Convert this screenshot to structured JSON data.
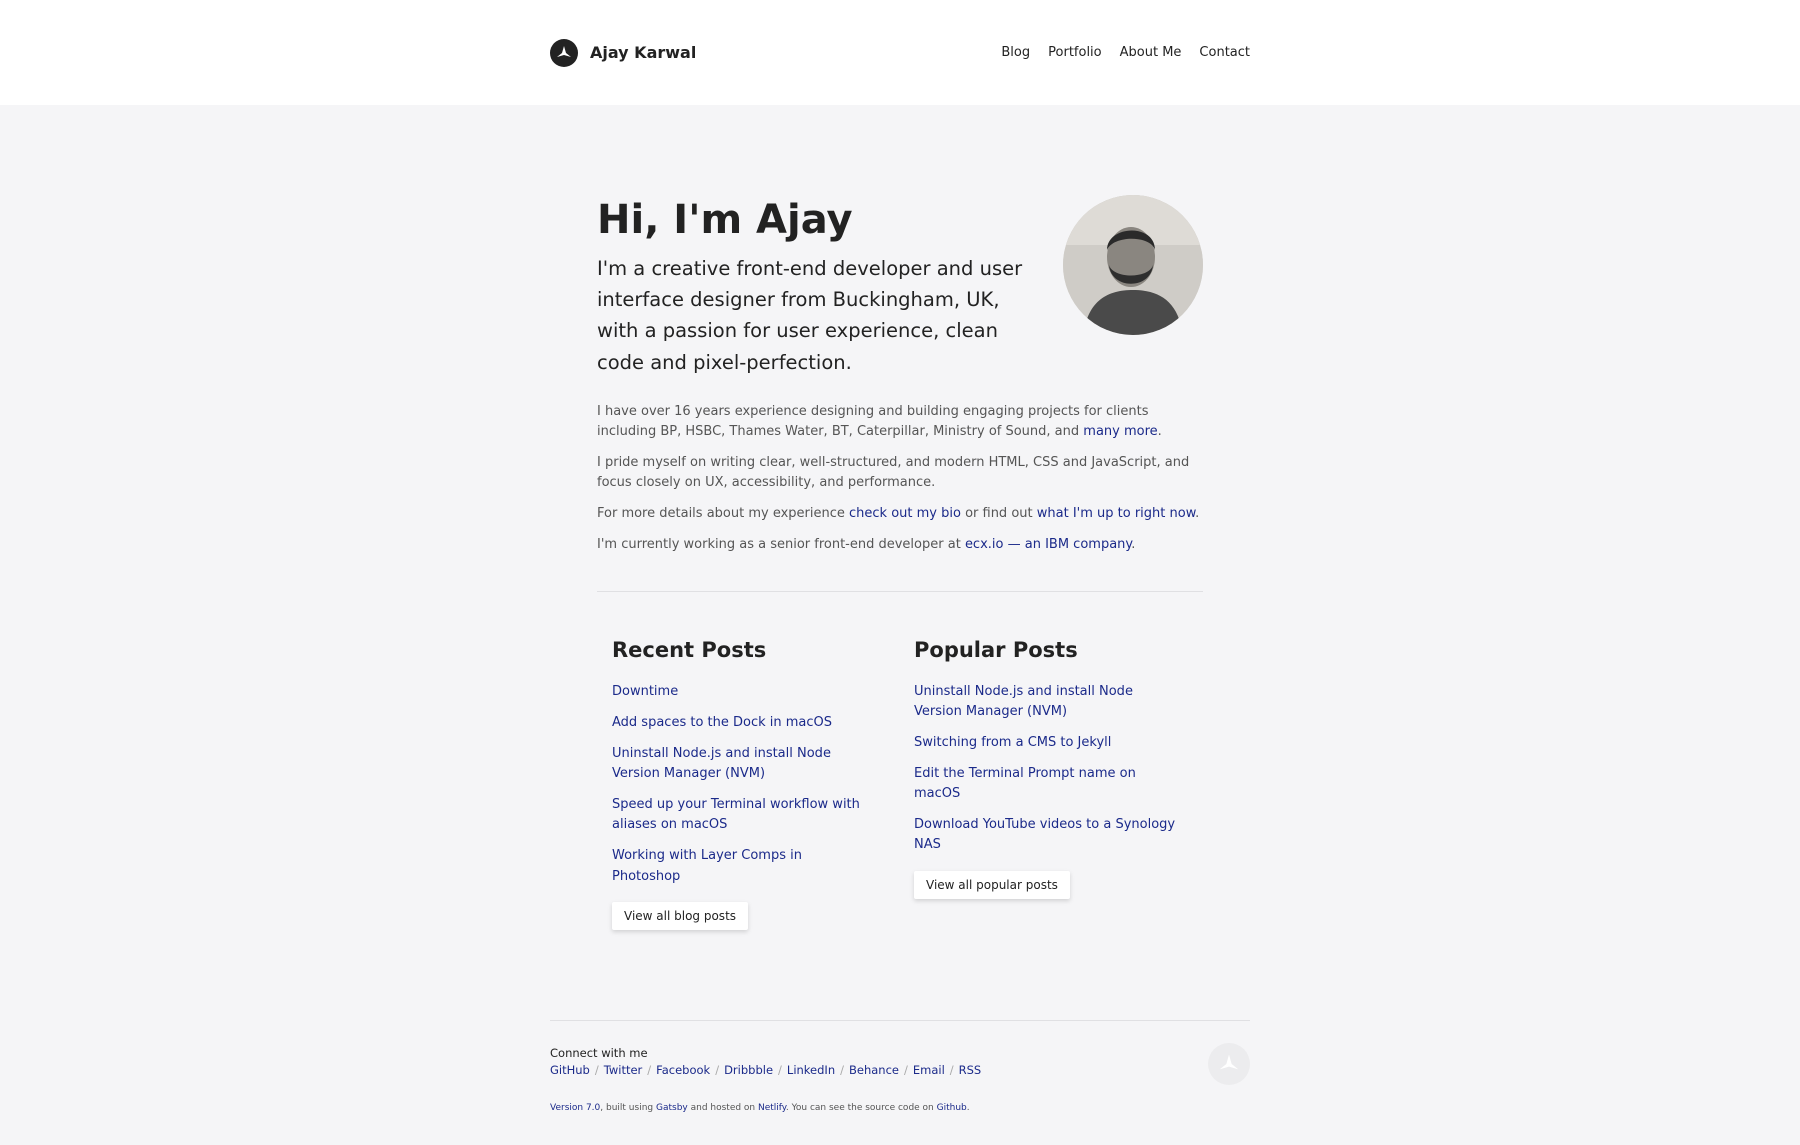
{
  "header": {
    "logo_icon": "ajay-karwal-logo",
    "brand_name": "Ajay Karwal",
    "nav": [
      "Blog",
      "Portfolio",
      "About Me",
      "Contact"
    ]
  },
  "intro": {
    "heading": "Hi, I'm Ajay",
    "lead": "I'm a creative front-end developer and user interface designer from Buckingham, UK, with a passion for user experience, clean code and pixel-perfection.",
    "p1_text": "I have over 16 years experience designing and building engaging projects for clients including BP, HSBC, Thames Water, BT, Caterpillar, Ministry of Sound, and ",
    "p1_link": "many more",
    "p1_end": ".",
    "p2": "I pride myself on writing clear, well-structured, and modern HTML, CSS and JavaScript, and focus closely on UX, accessibility, and performance.",
    "p3_a": "For more details about my experience ",
    "p3_link1": "check out my bio",
    "p3_b": " or find out ",
    "p3_link2": "what I'm up to right now",
    "p3_end": ".",
    "p4_a": "I'm currently working as a senior front-end developer at ",
    "p4_link": "ecx.io — an IBM company",
    "p4_end": "."
  },
  "recent": {
    "title": "Recent Posts",
    "items": [
      "Downtime",
      "Add spaces to the Dock in macOS",
      "Uninstall Node.js and install Node Version Manager (NVM)",
      "Speed up your Terminal workflow with aliases on macOS",
      "Working with Layer Comps in Photoshop"
    ],
    "button": "View all blog posts"
  },
  "popular": {
    "title": "Popular Posts",
    "items": [
      "Uninstall Node.js and install Node Version Manager (NVM)",
      "Switching from a CMS to Jekyll",
      "Edit the Terminal Prompt name on macOS",
      "Download YouTube videos to a Synology NAS"
    ],
    "button": "View all popular posts"
  },
  "footer": {
    "connect": "Connect with me",
    "social": [
      "GitHub",
      "Twitter",
      "Facebook",
      "Dribbble",
      "LinkedIn",
      "Behance",
      "Email",
      "RSS"
    ],
    "version": "Version 7.0",
    "c1": ", built using ",
    "gatsby": "Gatsby",
    "c2": " and hosted on ",
    "netlify": "Netlify",
    "c3": ". You can see the source code on ",
    "github": "Github",
    "c4": "."
  },
  "colors": {
    "link": "#1b2a8a",
    "background": "#f5f5f7",
    "text": "#222222"
  }
}
